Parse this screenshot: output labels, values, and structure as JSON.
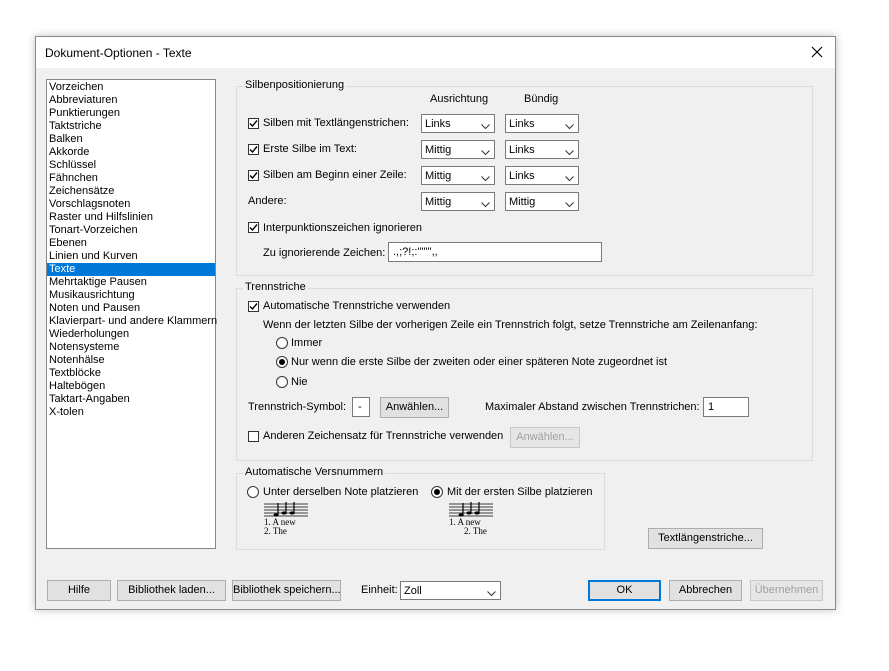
{
  "window": {
    "title": "Dokument-Optionen - Texte"
  },
  "categories": [
    "Vorzeichen",
    "Abbreviaturen",
    "Punktierungen",
    "Taktstriche",
    "Balken",
    "Akkorde",
    "Schlüssel",
    "Fähnchen",
    "Zeichensätze",
    "Vorschlagsnoten",
    "Raster und Hilfslinien",
    "Tonart-Vorzeichen",
    "Ebenen",
    "Linien und Kurven",
    "Texte",
    "Mehrtaktige Pausen",
    "Musikausrichtung",
    "Noten und Pausen",
    "Klavierpart- und andere Klammern",
    "Wiederholungen",
    "Notensysteme",
    "Notenhälse",
    "Textblöcke",
    "Haltebögen",
    "Taktart-Angaben",
    "X-tolen"
  ],
  "selected_category": "Texte",
  "syllable": {
    "legend": "Silbenpositionierung",
    "col_alignment": "Ausrichtung",
    "col_flush": "Bündig",
    "rows": [
      {
        "label": "Silben mit Textlängenstrichen:",
        "checked": true,
        "alignment": "Links",
        "flush": "Links"
      },
      {
        "label": "Erste Silbe im Text:",
        "checked": true,
        "alignment": "Mittig",
        "flush": "Links"
      },
      {
        "label": "Silben am Beginn einer Zeile:",
        "checked": true,
        "alignment": "Mittig",
        "flush": "Links"
      },
      {
        "label": "Andere:",
        "checked": null,
        "alignment": "Mittig",
        "flush": "Mittig"
      }
    ],
    "ignore_punct_label": "Interpunktionszeichen ignorieren",
    "ignore_chars_label": "Zu ignorierende Zeichen:",
    "ignore_chars_value": ".,;?!;:'\"\"'',,"
  },
  "hyphens": {
    "legend": "Trennstriche",
    "auto_label": "Automatische Trennstriche verwenden",
    "description": "Wenn der letzten Silbe der vorherigen Zeile ein Trennstrich folgt, setze Trennstriche am Zeilenanfang:",
    "options": [
      "Immer",
      "Nur wenn die erste Silbe der zweiten oder einer späteren Note zugeordnet ist",
      "Nie"
    ],
    "selected_option": 1,
    "symbol_label": "Trennstrich-Symbol:",
    "symbol_value": "-",
    "choose_label": "Anwählen...",
    "max_distance_label": "Maximaler Abstand zwischen Trennstrichen:",
    "max_distance_value": "1",
    "other_font_label": "Anderen Zeichensatz für Trennstriche verwenden",
    "other_font_choose_label": "Anwählen..."
  },
  "verse": {
    "legend": "Automatische Versnummern",
    "option1": "Unter derselben Note platzieren",
    "option2": "Mit der ersten Silbe platzieren",
    "selected": 2,
    "preview1": {
      "line1": "1. A   new",
      "line2": "2.     The"
    },
    "preview2": {
      "line1": "1. A   new",
      "line2": "2. The"
    }
  },
  "text_extension_button": "Textlängenstriche...",
  "footer": {
    "help": "Hilfe",
    "load_library": "Bibliothek laden...",
    "save_library": "Bibliothek speichern...",
    "unit_label": "Einheit:",
    "unit_value": "Zoll",
    "ok": "OK",
    "cancel": "Abbrechen",
    "apply": "Übernehmen"
  },
  "colors": {
    "selection": "#0078d7",
    "dialog_bg": "#f0f0f0"
  }
}
